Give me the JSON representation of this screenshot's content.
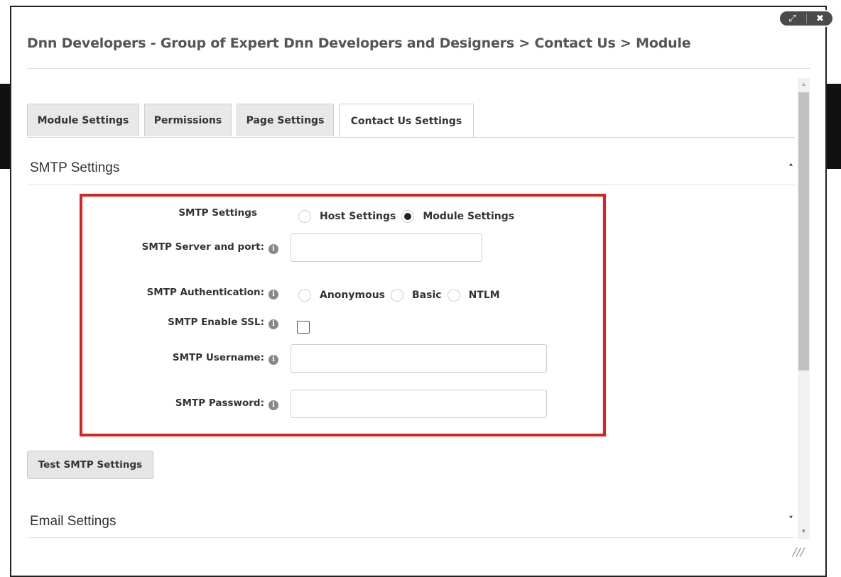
{
  "dialog": {
    "title": "Dnn Developers - Group of Expert Dnn Developers and Designers > Contact Us > Module",
    "controls": {
      "maximize_icon": "⤢",
      "close_icon": "✖"
    }
  },
  "tabs": [
    {
      "label": "Module Settings"
    },
    {
      "label": "Permissions"
    },
    {
      "label": "Page Settings"
    },
    {
      "label": "Contact Us Settings"
    }
  ],
  "smtp_section": {
    "title": "SMTP Settings",
    "chevron": "˄",
    "smtp_settings": {
      "label": "SMTP Settings",
      "options": [
        {
          "label": "Host Settings",
          "selected": false
        },
        {
          "label": "Module Settings",
          "selected": true
        }
      ]
    },
    "server": {
      "label": "SMTP Server and port:",
      "value": ""
    },
    "authentication": {
      "label": "SMTP Authentication:",
      "options": [
        {
          "label": "Anonymous",
          "selected": false
        },
        {
          "label": "Basic",
          "selected": false
        },
        {
          "label": "NTLM",
          "selected": false
        }
      ]
    },
    "ssl": {
      "label": "SMTP Enable SSL:",
      "checked": false
    },
    "username": {
      "label": "SMTP Username:",
      "value": ""
    },
    "password": {
      "label": "SMTP Password:",
      "value": ""
    },
    "info_icon": "i",
    "highlight_color": "#e02020"
  },
  "test_button": {
    "label": "Test SMTP Settings"
  },
  "email_section": {
    "title": "Email Settings",
    "chevron": "˅"
  }
}
